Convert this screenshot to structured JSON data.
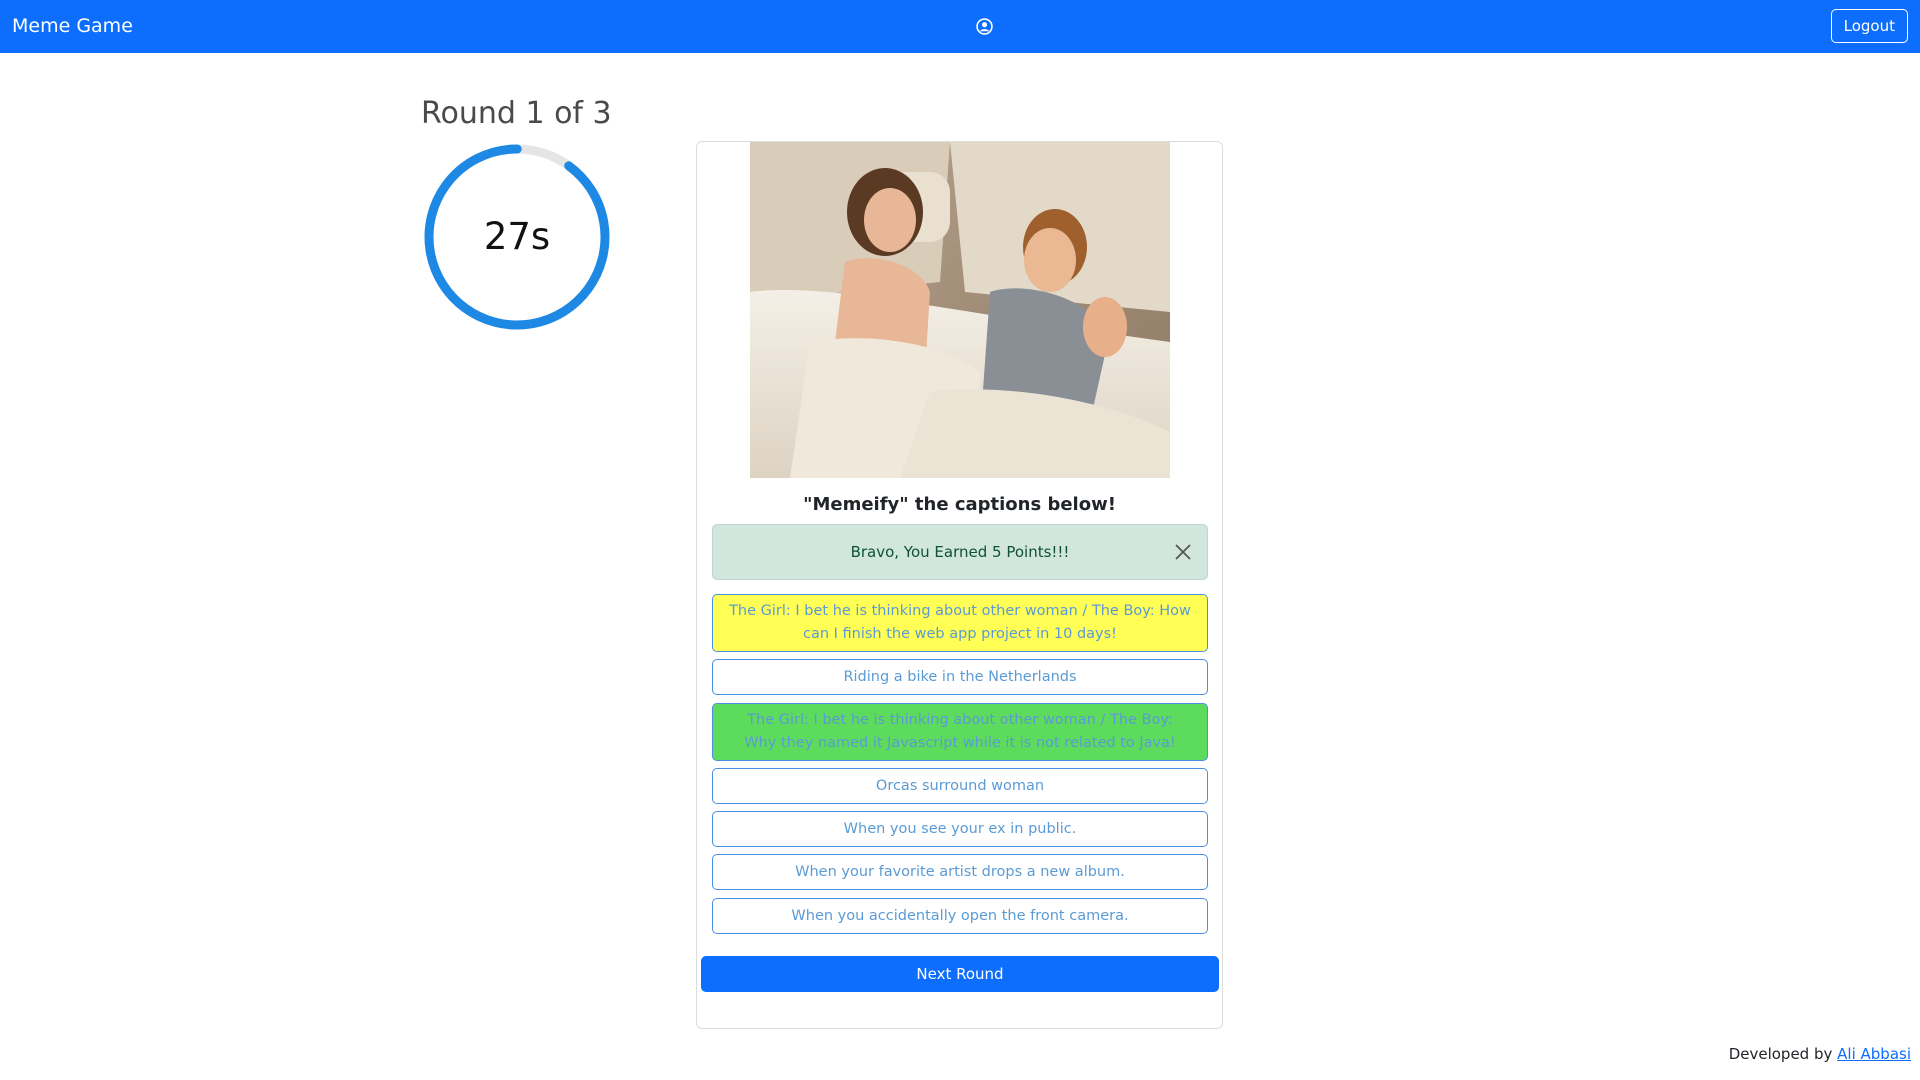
{
  "navbar": {
    "brand": "Meme Game",
    "user_icon": "user-circle-icon",
    "logout_label": "Logout",
    "color": "#0d6efd"
  },
  "round": {
    "title": "Round 1 of 3",
    "timer_text": "27s",
    "timer_seconds": 27,
    "timer_fraction": 0.9
  },
  "card": {
    "image_alt": "meme-image-couple-in-bed",
    "heading": "\"Memeify\" the captions below!",
    "alert_text": "Bravo, You Earned 5 Points!!!",
    "alert_close_icon": "close-icon",
    "options": [
      {
        "text": "The Girl: I bet he is thinking about other woman / The Boy: How can I finish the web app project in 10 days!",
        "state": "selected"
      },
      {
        "text": "Riding a bike in the Netherlands",
        "state": "normal"
      },
      {
        "text": "The Girl: I bet he is thinking about other woman / The Boy: Why they named it Javascript while it is not related to Java!",
        "state": "correct"
      },
      {
        "text": "Orcas surround woman",
        "state": "normal"
      },
      {
        "text": "When you see your ex in public.",
        "state": "normal"
      },
      {
        "text": "When your favorite artist drops a new album.",
        "state": "normal"
      },
      {
        "text": "When you accidentally open the front camera.",
        "state": "normal"
      }
    ],
    "next_label": "Next Round"
  },
  "footer": {
    "prefix": "Developed by",
    "author": "Ali Abbasi"
  },
  "colors": {
    "selected": "#ffff55",
    "correct": "#5cdb5c",
    "alert_bg": "#d1e7dd",
    "timer_ring": "#1e88e5"
  }
}
